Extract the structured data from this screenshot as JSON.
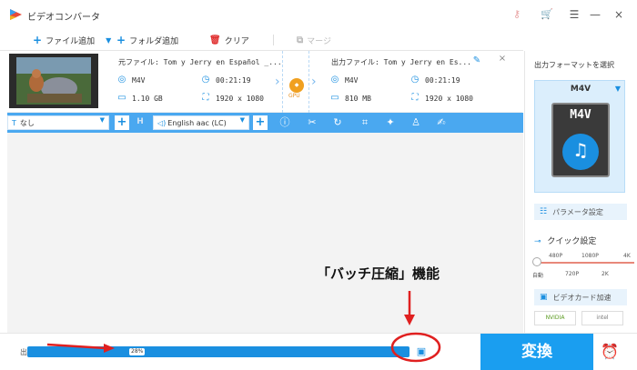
{
  "window": {
    "title": "ビデオコンバータ",
    "controls": [
      "—",
      "×"
    ]
  },
  "toolbar": {
    "add_file": "ファイル追加",
    "add_folder": "フォルダ追加",
    "clear": "クリア",
    "merge": "マージ"
  },
  "file": {
    "source_name": "元ファイル: Tom y Jerry en Español _...",
    "source_format": "M4V",
    "source_duration": "00:21:19",
    "source_size": "1.10 GB",
    "source_resolution": "1920 x 1080",
    "output_name": "出力ファイル: Tom y Jerry en Es...",
    "output_format": "M4V",
    "output_duration": "00:21:19",
    "output_size": "810 MB",
    "output_resolution": "1920 x 1080",
    "gpu_label": "GPU"
  },
  "edit_strip": {
    "subtitle_value": "なし",
    "audio_value": "English aac (LC)"
  },
  "right_panel": {
    "title": "出力フォーマットを選択",
    "format": "M4V",
    "format_icon_label": "M4V",
    "parameter_button": "パラメータ設定",
    "quick_settings": "クイック設定",
    "res_top": [
      "480P",
      "1080P",
      "4K"
    ],
    "res_bottom": [
      "自動",
      "720P",
      "2K"
    ],
    "gpu_accel": "ビデオカード加速",
    "vendors": [
      "NVIDIA",
      "intel"
    ]
  },
  "bottom": {
    "output_label": "出",
    "progress_pct": "28%",
    "progress_value": 0.28,
    "convert_button": "変換"
  },
  "annotation": {
    "text": "「バッチ圧縮」機能",
    "color": "#e02020"
  },
  "colors": {
    "accent": "#1a8fe0",
    "strip": "#4aa8f0",
    "convert": "#1a9ef0"
  }
}
